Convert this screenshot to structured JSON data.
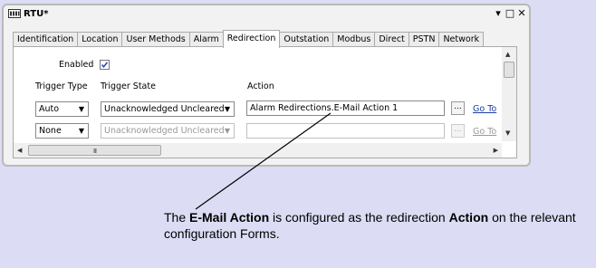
{
  "window": {
    "title": "RTU*",
    "controls": {
      "minimize": "▾",
      "restore": "□",
      "close": "✕"
    }
  },
  "tabs": [
    "Identification",
    "Location",
    "User Methods",
    "Alarm",
    "Redirection",
    "Outstation",
    "Modbus",
    "Direct",
    "PSTN",
    "Network"
  ],
  "active_tab": "Redirection",
  "form": {
    "enabled_label": "Enabled",
    "enabled_checked": true,
    "columns": {
      "trigger_type": "Trigger Type",
      "trigger_state": "Trigger State",
      "action": "Action"
    },
    "rows": [
      {
        "trigger_type": "Auto",
        "trigger_state": "Unacknowledged Uncleared",
        "action": "Alarm Redirections.E-Mail Action 1",
        "browse": "...",
        "goto": "Go To",
        "enabled": true
      },
      {
        "trigger_type": "None",
        "trigger_state": "Unacknowledged Uncleared",
        "action": "",
        "browse": "...",
        "goto": "Go To",
        "enabled": false
      }
    ]
  },
  "scrollbar_grip": "III",
  "callout": {
    "part1": "The ",
    "bold1": "E-Mail Action",
    "part2": " is configured as the redirection ",
    "bold2": "Action",
    "part3": " on the relevant configuration Forms."
  },
  "colors": {
    "background": "#dcdcf4",
    "link": "#1a3fa0"
  }
}
